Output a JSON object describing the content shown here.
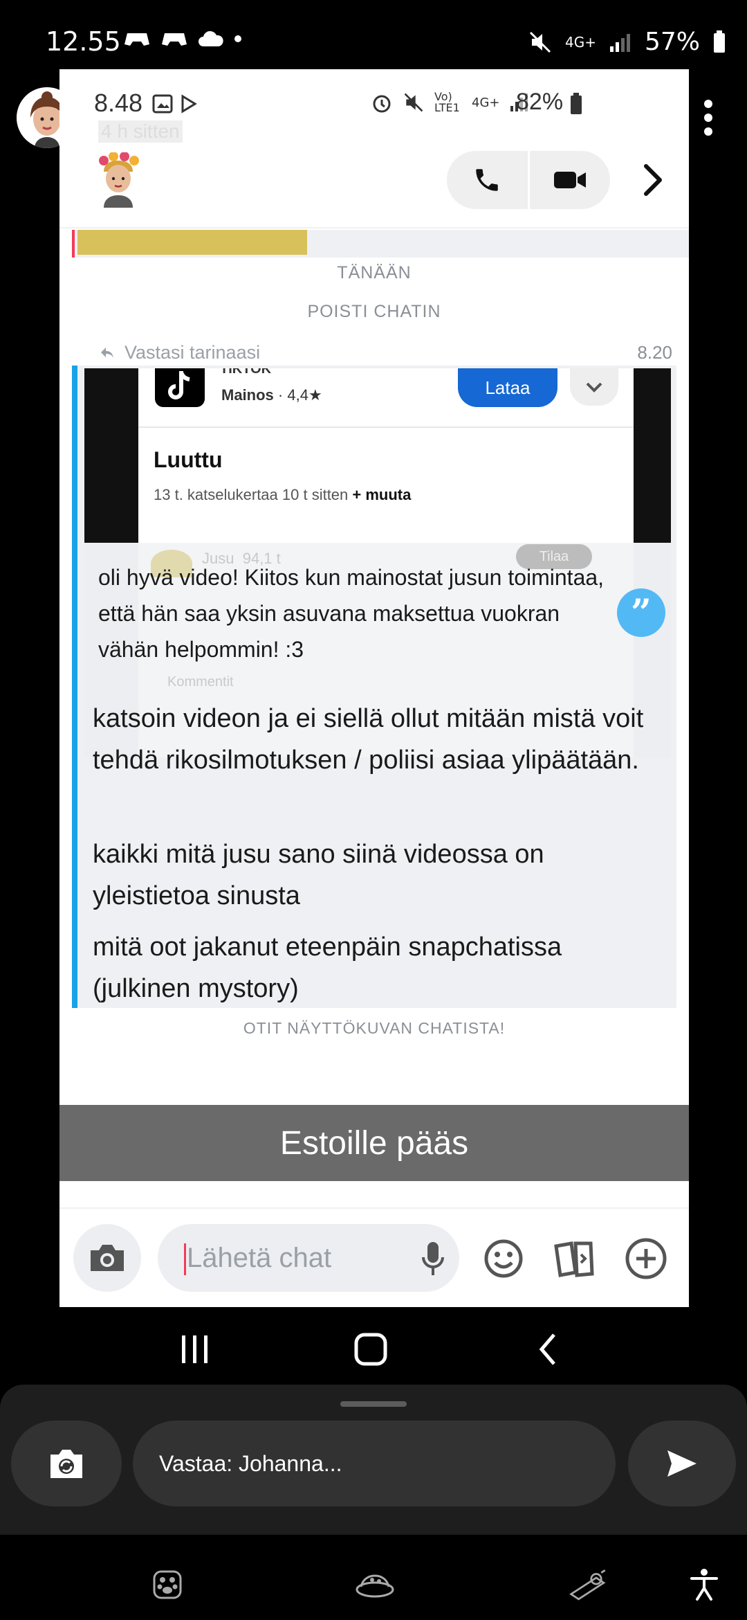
{
  "outer_status": {
    "time": "12.55",
    "battery": "57%",
    "network": "4G+"
  },
  "inner_status": {
    "time": "8.48",
    "subtitle": "4 h sitten",
    "battery": "82%",
    "network_volte": "Vo) LTE1",
    "network": "4G+"
  },
  "chat": {
    "date_label": "TÄNÄÄN",
    "system_cleared": "POISTI CHATIN",
    "reply_label": "Vastasi tarinaasi",
    "reply_time": "8.20",
    "story": {
      "app_name": "TIKTOK",
      "ad_label": "Mainos",
      "rating": "· 4,4★",
      "download_label": "Lataa",
      "video_title": "Luuttu",
      "video_meta": "13 t. katselukertaa  10 t sitten",
      "video_more": "+ muuta",
      "faded_name": "Jusu",
      "faded_count": "94,1 t",
      "faded_subscribe": "Tilaa",
      "faded_comments": "Kommentit",
      "caption": "oli hyvä video! Kiitos kun mainostat jusun toimintaa, että hän saa yksin asuvana maksettua vuokran vähän helpommin! :3"
    },
    "messages": [
      "katsoin videon ja ei siellä ollut mitään mistä voit tehdä rikosilmotuksen / poliisi asiaa ylipäätään.",
      "kaikki mitä jusu sano siinä videossa on yleistietoa sinusta",
      "mitä oot jakanut eteenpäin snapchatissa (julkinen mystory)"
    ],
    "screenshot_notice": "OTIT NÄYTTÖKUVAN CHATISTA!",
    "overlay_caption": "Estoille pääs",
    "input_placeholder": "Lähetä chat"
  },
  "reply_sheet": {
    "reply_text": "Vastaa: Johanna..."
  },
  "colors": {
    "accent_blue": "#18a2e9",
    "accent_red": "#f23c57",
    "tiktok_blue": "#1668d4",
    "sheet_bg": "#1e1e1e"
  },
  "icons": [
    "camera-icon",
    "mic-icon",
    "emoji-icon",
    "cards-icon",
    "plus-icon",
    "phone-icon",
    "video-icon",
    "chevron-right-icon",
    "more-icon",
    "send-icon",
    "camera-flip-icon"
  ]
}
